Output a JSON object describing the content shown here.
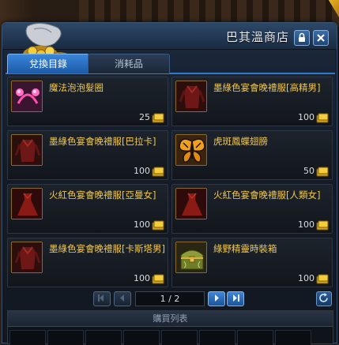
{
  "window": {
    "title": "巴其溫商店"
  },
  "tabs": [
    {
      "label": "兌換目錄",
      "active": true
    },
    {
      "label": "消耗品",
      "active": false
    }
  ],
  "items": [
    {
      "name": "魔法泡泡髮圈",
      "price": "25",
      "icon": "pink-hair-band-icon"
    },
    {
      "name": "墨綠色宴會晚禮服[高精男]",
      "price": "100",
      "icon": "dark-red-outfit-icon"
    },
    {
      "name": "墨綠色宴會晚禮服[巴拉卡]",
      "price": "100",
      "icon": "dark-red-outfit-icon"
    },
    {
      "name": "虎斑鳳蝶翅膀",
      "price": "50",
      "icon": "butterfly-wings-icon"
    },
    {
      "name": "火紅色宴會晚禮服[亞曼女]",
      "price": "100",
      "icon": "red-dress-icon"
    },
    {
      "name": "火紅色宴會晚禮服[人類女]",
      "price": "100",
      "icon": "red-dress-icon"
    },
    {
      "name": "墨綠色宴會晚禮服[卡斯塔男]",
      "price": "100",
      "icon": "dark-red-outfit-icon"
    },
    {
      "name": "綠野精靈時裝箱",
      "price": "100",
      "icon": "treasure-chest-icon"
    }
  ],
  "pager": {
    "indicator": "1 / 2"
  },
  "purchase_list": {
    "header": "購買列表"
  },
  "colors": {
    "item_name": "#f2c84a",
    "tab_active": "#2e7bd0",
    "window_bg": "#141c28"
  }
}
